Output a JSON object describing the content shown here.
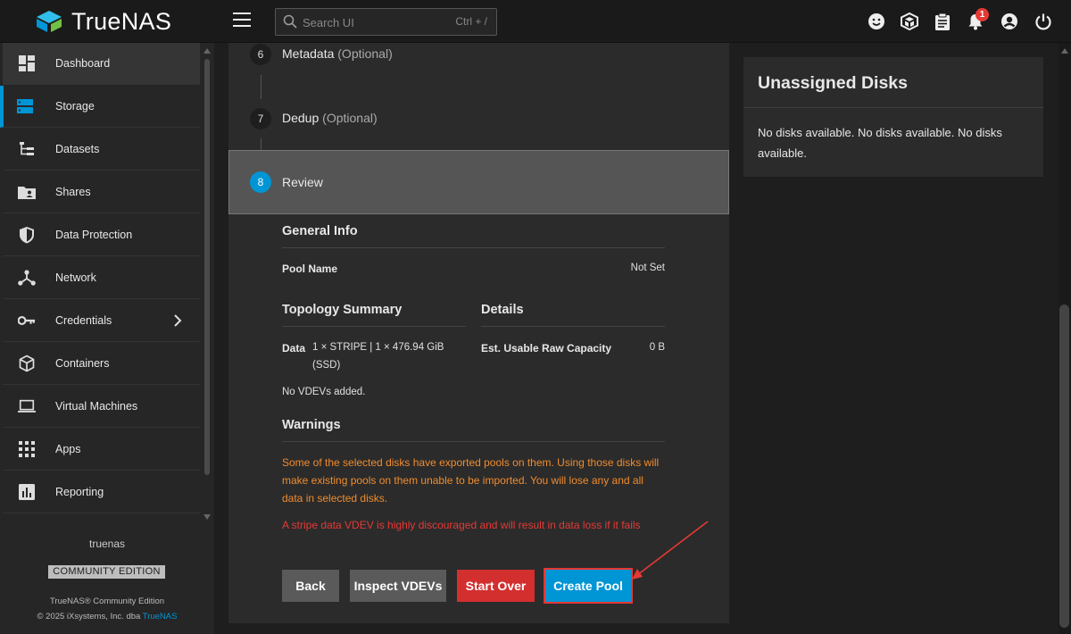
{
  "app": {
    "name": "TrueNAS",
    "brand_color": "#0095d5"
  },
  "search": {
    "placeholder": "Search UI",
    "shortcut": "Ctrl + /"
  },
  "topbar": {
    "notification_count": "1"
  },
  "sidebar": {
    "items": [
      {
        "label": "Dashboard",
        "icon": "dashboard-icon"
      },
      {
        "label": "Storage",
        "icon": "storage-icon",
        "active": true
      },
      {
        "label": "Datasets",
        "icon": "datasets-icon"
      },
      {
        "label": "Shares",
        "icon": "shares-icon"
      },
      {
        "label": "Data Protection",
        "icon": "shield-icon"
      },
      {
        "label": "Network",
        "icon": "network-icon"
      },
      {
        "label": "Credentials",
        "icon": "key-icon"
      },
      {
        "label": "Containers",
        "icon": "cube-icon"
      },
      {
        "label": "Virtual Machines",
        "icon": "laptop-icon"
      },
      {
        "label": "Apps",
        "icon": "apps-grid-icon"
      },
      {
        "label": "Reporting",
        "icon": "chart-icon"
      }
    ],
    "hostname": "truenas",
    "edition": "COMMUNITY EDITION",
    "footer_line1": "TrueNAS® Community Edition",
    "footer_line2_prefix": "© 2025 iXsystems, Inc. dba ",
    "footer_link": "TrueNAS"
  },
  "steps": [
    {
      "num": "6",
      "label": "Metadata",
      "optional": "(Optional)"
    },
    {
      "num": "7",
      "label": "Dedup",
      "optional": "(Optional)"
    },
    {
      "num": "8",
      "label": "Review"
    }
  ],
  "review": {
    "general_info": "General Info",
    "pool_name_label": "Pool Name",
    "pool_name_value": "Not Set",
    "topology_summary": "Topology Summary",
    "details": "Details",
    "data_label": "Data",
    "data_value_line1": "1 × STRIPE | 1 × 476.94 GiB",
    "data_value_line2": "(SSD)",
    "est_capacity_label": "Est. Usable Raw Capacity",
    "est_capacity_value": "0 B",
    "no_vdevs": "No VDEVs added.",
    "warnings": "Warnings",
    "warning_exported": "Some of the selected disks have exported pools on them. Using those disks will make existing pools on them unable to be imported. You will lose any and all data in selected disks.",
    "warning_stripe": "A stripe data VDEV is highly discouraged and will result in data loss if it fails"
  },
  "buttons": {
    "back": "Back",
    "inspect": "Inspect VDEVs",
    "start_over": "Start Over",
    "create_pool": "Create Pool"
  },
  "unassigned": {
    "title": "Unassigned Disks",
    "message": "No disks available. No disks available. No disks available."
  },
  "colors": {
    "warning_orange": "#f08c2e",
    "error_red": "#e53935",
    "accent": "#0095d5"
  }
}
